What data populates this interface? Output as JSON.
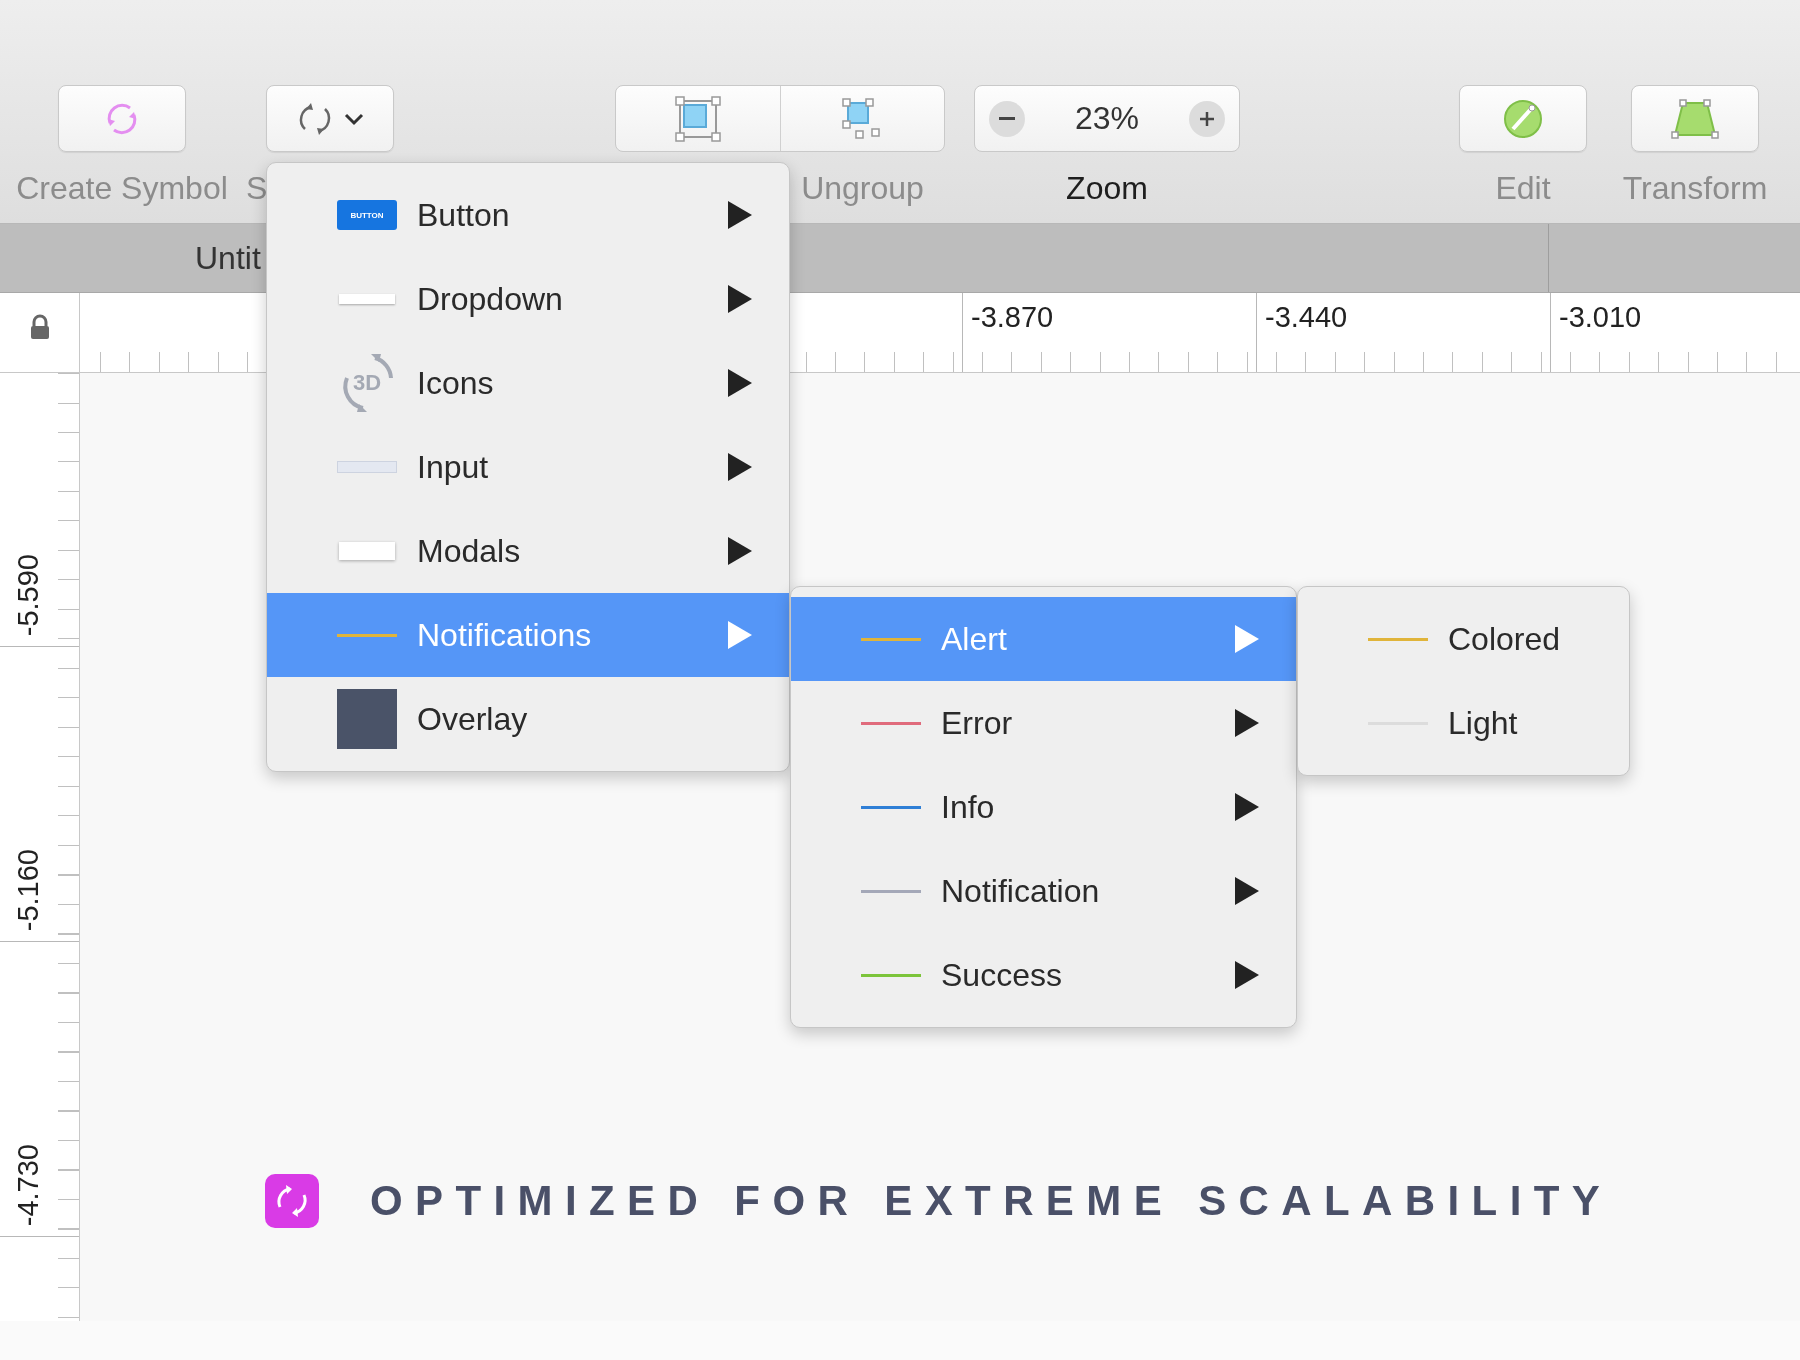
{
  "toolbar": [
    {
      "kind": "create-symbol",
      "label": "Create Symbol",
      "dimmed": true
    },
    {
      "kind": "symbol-menu",
      "label": "S",
      "dimmed": true
    },
    {
      "kind": "arrange",
      "label": "Ungroup",
      "dimmed": true
    },
    {
      "kind": "zoom",
      "value": "23%",
      "label": "Zoom",
      "dimmed": false
    },
    {
      "kind": "edit",
      "label": "Edit",
      "dimmed": true
    },
    {
      "kind": "transform",
      "label": "Transform",
      "dimmed": true
    }
  ],
  "tab_bar": {
    "title": "Untit"
  },
  "rulers": {
    "horizontal": [
      "-3.870",
      "-3.440",
      "-3.010"
    ],
    "vertical": [
      "-5.590",
      "-5.160",
      "-4.730"
    ]
  },
  "menus": [
    {
      "items": [
        {
          "kind": "button-thumb",
          "thumb_text": "BUTTON",
          "label": "Button",
          "submenu": true,
          "selected": false
        },
        {
          "kind": "dropdown-thumb",
          "label": "Dropdown",
          "submenu": true,
          "selected": false
        },
        {
          "kind": "icons-thumb",
          "thumb_text": "3D",
          "label": "Icons",
          "submenu": true,
          "selected": false
        },
        {
          "kind": "input-thumb",
          "label": "Input",
          "submenu": true,
          "selected": false
        },
        {
          "kind": "modal-thumb",
          "label": "Modals",
          "submenu": true,
          "selected": false
        },
        {
          "kind": "line",
          "color": "#e0b43a",
          "label": "Notifications",
          "submenu": true,
          "selected": true
        },
        {
          "kind": "swatch",
          "color": "#4a5368",
          "label": "Overlay",
          "submenu": false,
          "selected": false
        }
      ]
    },
    {
      "items": [
        {
          "kind": "line",
          "color": "#e0b43a",
          "label": "Alert",
          "submenu": true,
          "selected": true
        },
        {
          "kind": "line",
          "color": "#e06b7c",
          "label": "Error",
          "submenu": true,
          "selected": false
        },
        {
          "kind": "line",
          "color": "#2f7fd6",
          "label": "Info",
          "submenu": true,
          "selected": false
        },
        {
          "kind": "line",
          "color": "#a4a8b8",
          "label": "Notification",
          "submenu": true,
          "selected": false
        },
        {
          "kind": "line",
          "color": "#7cc43a",
          "label": "Success",
          "submenu": true,
          "selected": false
        }
      ]
    },
    {
      "items": [
        {
          "kind": "line",
          "color": "#e0b43a",
          "label": "Colored",
          "submenu": false,
          "selected": false
        },
        {
          "kind": "line",
          "color": "#dcdcdc",
          "label": "Light",
          "submenu": false,
          "selected": false
        }
      ]
    }
  ],
  "tagline": {
    "text": "OPTIMIZED FOR EXTREME SCALABILITY"
  }
}
